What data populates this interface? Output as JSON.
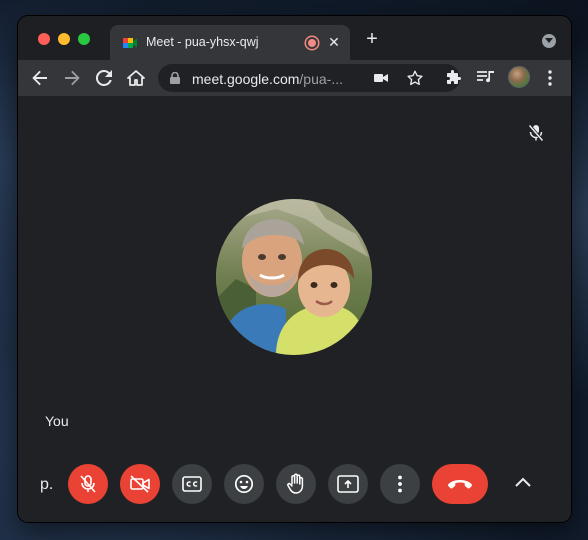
{
  "browser": {
    "tab": {
      "title": "Meet - pua-yhsx-qwj",
      "close_label": "✕",
      "recording_indicator": "recording-dot"
    },
    "new_tab_label": "+",
    "address": {
      "host": "meet.google.com",
      "path": "/pua-..."
    },
    "colors": {
      "tab_bg": "#35363a",
      "window_bg": "#202124",
      "close_red": "#ff5f57",
      "minimize_yellow": "#febc2e",
      "zoom_green": "#28c840"
    }
  },
  "meet": {
    "self_label": "You",
    "meeting_code_fragment": "p.",
    "controls": [
      {
        "id": "microphone",
        "state": "off",
        "color": "#ea4335"
      },
      {
        "id": "camera",
        "state": "off",
        "color": "#ea4335"
      },
      {
        "id": "captions",
        "state": "off",
        "color": "#3c4043"
      },
      {
        "id": "reactions",
        "state": "off",
        "color": "#3c4043"
      },
      {
        "id": "raise-hand",
        "state": "off",
        "color": "#3c4043"
      },
      {
        "id": "present",
        "state": "off",
        "color": "#3c4043"
      },
      {
        "id": "more-options",
        "state": "off",
        "color": "#3c4043"
      },
      {
        "id": "leave-call",
        "state": "active",
        "color": "#ea4335"
      }
    ]
  }
}
